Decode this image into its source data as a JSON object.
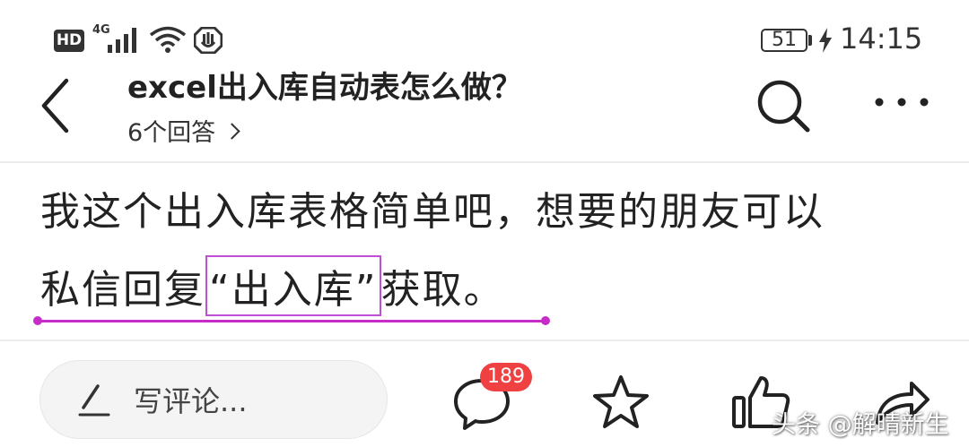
{
  "status_bar": {
    "hd": "HD",
    "network": "4G",
    "battery": "51",
    "time": "14:15"
  },
  "header": {
    "title": "excel出入库自动表怎么做？",
    "answers": "6个回答"
  },
  "content": {
    "line1": "我这个出入库表格简单吧，想要的朋友可以",
    "line2_prefix": "私信回复",
    "line2_highlight": "“出入库”",
    "line2_suffix": "获取。"
  },
  "bottom_bar": {
    "comment_placeholder": "写评论...",
    "comment_count": "189"
  },
  "watermark": "头条 @解晴新生",
  "colors": {
    "highlight_border": "#c14fd6",
    "underline": "#c62cc8",
    "badge": "#f04142"
  }
}
